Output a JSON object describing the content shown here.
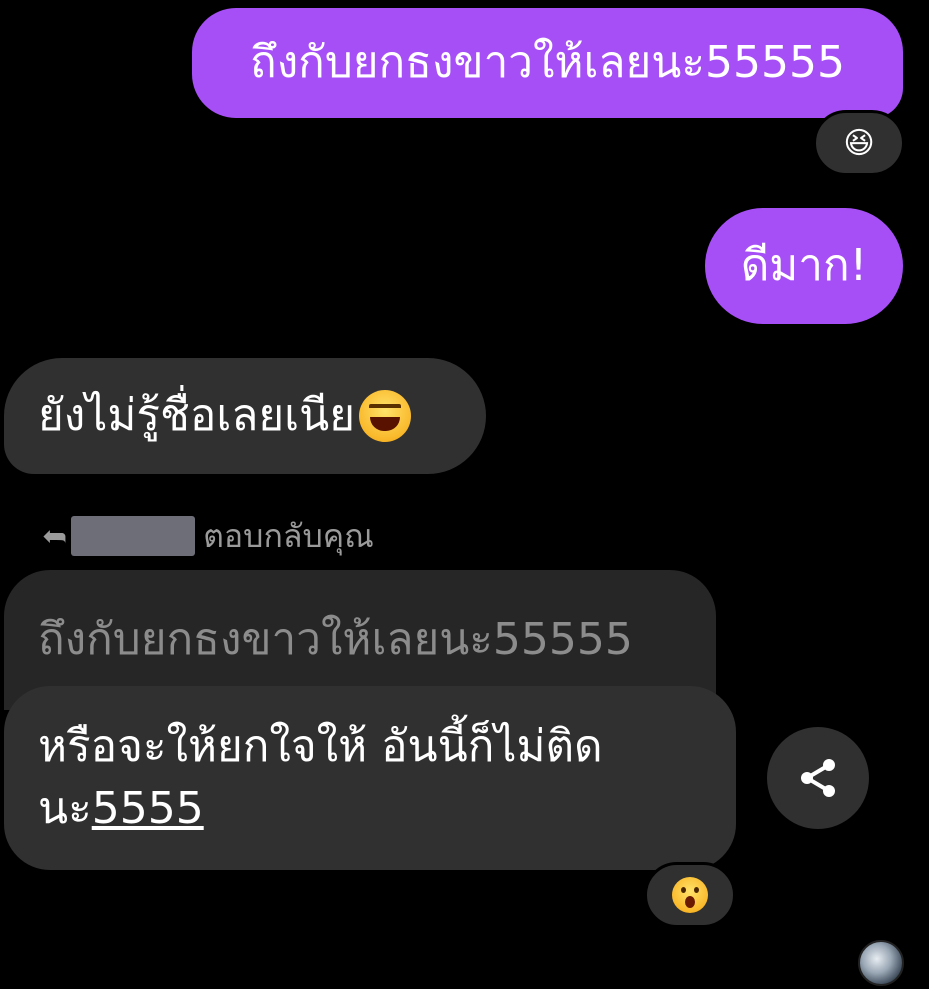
{
  "chat": {
    "messages": [
      {
        "direction": "outgoing",
        "text": "ถึงกับยกธงขาวให้เลยนะ55555"
      },
      {
        "direction": "outgoing",
        "text": "ดีมาก!"
      },
      {
        "direction": "incoming",
        "text": "ยังไม่รู้ชื่อเลยเนีย"
      },
      {
        "direction": "incoming",
        "line1": "หรือจะให้ยกใจให้ อันนี้ก็ไม่ติด",
        "line2_prefix": "นะ",
        "line2_link": "5555"
      }
    ],
    "reply": {
      "label": "ตอบกลับคุณ",
      "quoted_text": "ถึงกับยกธงขาวให้เลยนะ55555"
    },
    "reactions": {
      "first": "😆",
      "second": "wow-face-emoji"
    },
    "icons": {
      "reply_arrow": "reply-arrow-icon",
      "share": "share-icon",
      "read_receipt": "avatar"
    },
    "colors": {
      "outgoing_bubble": "#a64ff7",
      "incoming_bubble": "#303030",
      "quoted_bubble": "#262626",
      "background": "#000000"
    }
  }
}
